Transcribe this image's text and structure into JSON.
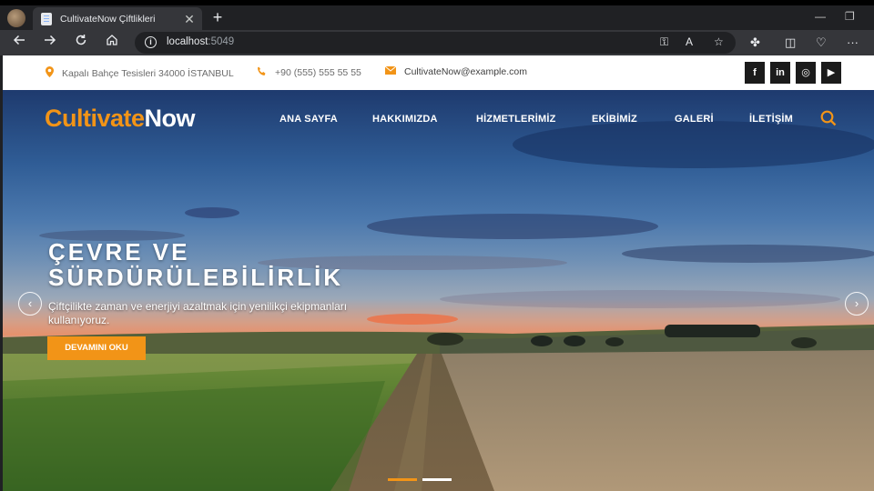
{
  "browser": {
    "tab_title": "CultivateNow Çiftlikleri",
    "tab_close": "✕",
    "new_tab": "+",
    "url_host": "localhost",
    "url_port": ":5049",
    "minimize": "—",
    "restore": "❐"
  },
  "topbar": {
    "address": "Kapalı Bahçe Tesisleri 34000 İSTANBUL",
    "phone": "+90 (555) 555 55 55",
    "email": "CultivateNow@example.com",
    "social": [
      {
        "label": "f",
        "icon": "facebook-icon"
      },
      {
        "label": "in",
        "icon": "linkedin-icon"
      },
      {
        "label": "◎",
        "icon": "instagram-icon"
      },
      {
        "label": "▶",
        "icon": "youtube-icon"
      }
    ]
  },
  "nav": {
    "logo_part1": "Cultivate",
    "logo_part2": "Now",
    "items": [
      "ANA SAYFA",
      "HAKKIMIZDA",
      "HİZMETLERİMİZ",
      "EKİBİMİZ",
      "GALERİ",
      "İLETİŞİM"
    ]
  },
  "slide": {
    "title_line1": "ÇEVRE VE",
    "title_line2": "SÜRDÜRÜLEBİLİRLİK",
    "text": "Çiftçilikte zaman ve enerjiyi azaltmak için yenilikçi ekipmanları kullanıyoruz.",
    "button": "DEVAMINI OKU",
    "prev": "‹",
    "next": "›",
    "active_slide": 1,
    "slide_count": 2
  },
  "colors": {
    "accent": "#f29417",
    "social_bg": "#1b1b1b"
  }
}
